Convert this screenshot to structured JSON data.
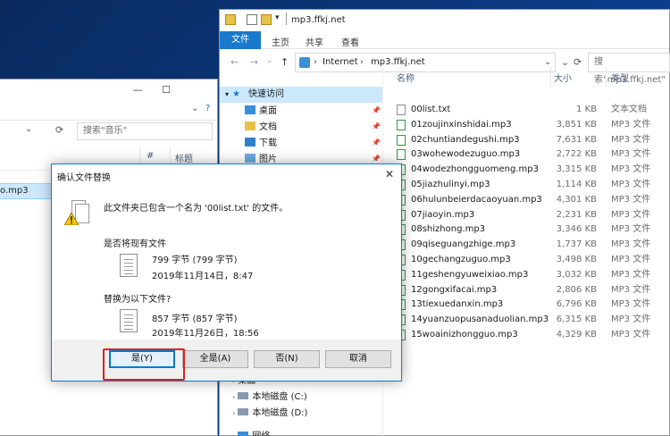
{
  "back_window": {
    "minimize": "—",
    "maximize": "☐",
    "search_placeholder": "搜索\"音乐\"",
    "columns": [
      "#",
      "标题"
    ],
    "selected_item_tail": "o.mp3"
  },
  "main_window": {
    "title": "mp3.ffkj.net",
    "ribbon": {
      "file": "文件",
      "tabs": [
        "主页",
        "共享",
        "查看"
      ]
    },
    "address": {
      "segments": [
        "Internet",
        "mp3.ffkj.net"
      ]
    },
    "search_placeholder": "搜索\"mp3.ffkj.net\"",
    "nav": {
      "quick_access": "快速访问",
      "items": [
        "桌面",
        "文档",
        "下载",
        "图片"
      ],
      "lower": [
        "桌面",
        "本地磁盘 (C:)",
        "本地磁盘 (D:)",
        "网络"
      ]
    },
    "columns": {
      "name": "名称",
      "size": "大小",
      "type": "类型"
    },
    "files": [
      {
        "name": "00list.txt",
        "size": "1 KB",
        "type": "文本文档"
      },
      {
        "name": "01zoujinxinshidai.mp3",
        "size": "3,851 KB",
        "type": "MP3 文件"
      },
      {
        "name": "02chuntiandegushi.mp3",
        "size": "7,631 KB",
        "type": "MP3 文件"
      },
      {
        "name": "03wohewodezuguo.mp3",
        "size": "2,722 KB",
        "type": "MP3 文件"
      },
      {
        "name": "04wodezhongguomeng.mp3",
        "size": "3,315 KB",
        "type": "MP3 文件"
      },
      {
        "name": "05jiazhulinyi.mp3",
        "size": "1,114 KB",
        "type": "MP3 文件"
      },
      {
        "name": "06hulunbeierdacaoyuan.mp3",
        "size": "4,301 KB",
        "type": "MP3 文件"
      },
      {
        "name": "07jiaoyin.mp3",
        "size": "2,231 KB",
        "type": "MP3 文件"
      },
      {
        "name": "08shizhong.mp3",
        "size": "3,346 KB",
        "type": "MP3 文件"
      },
      {
        "name": "09qiseguangzhige.mp3",
        "size": "1,737 KB",
        "type": "MP3 文件"
      },
      {
        "name": "10gechangzuguo.mp3",
        "size": "3,498 KB",
        "type": "MP3 文件"
      },
      {
        "name": "11geshengyuweixiao.mp3",
        "size": "3,032 KB",
        "type": "MP3 文件"
      },
      {
        "name": "12gongxifacai.mp3",
        "size": "2,806 KB",
        "type": "MP3 文件"
      },
      {
        "name": "13tiexuedanxin.mp3",
        "size": "6,796 KB",
        "type": "MP3 文件"
      },
      {
        "name": "14yuanzuopusanaduolian.mp3",
        "size": "6,315 KB",
        "type": "MP3 文件"
      },
      {
        "name": "15woainizhongguo.mp3",
        "size": "4,329 KB",
        "type": "MP3 文件"
      }
    ]
  },
  "dialog": {
    "title": "确认文件替换",
    "close": "✕",
    "message": "此文件夹已包含一个名为 '00list.txt' 的文件。",
    "existing_label": "是否将现有文件",
    "existing_size": "799 字节 (799 字节)",
    "existing_date": "2019年11月14日，8:47",
    "replace_label": "替换为以下文件?",
    "new_size": "857 字节 (857 字节)",
    "new_date": "2019年11月26日，18:56",
    "buttons": {
      "yes": "是(Y)",
      "yes_all": "全是(A)",
      "no": "否(N)",
      "cancel": "取消"
    }
  }
}
